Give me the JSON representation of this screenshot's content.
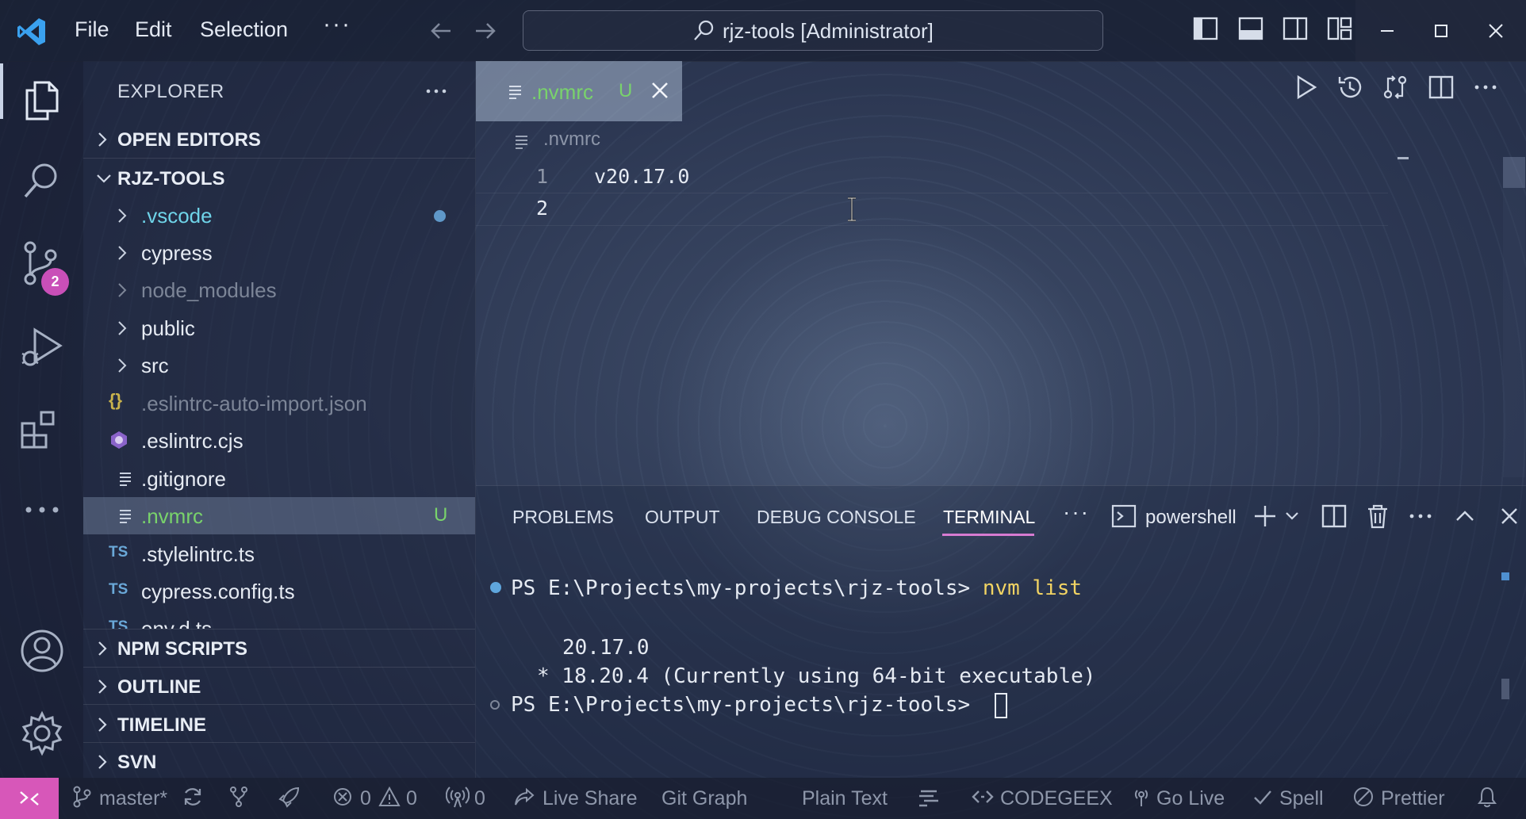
{
  "titlebar": {
    "menus": [
      "File",
      "Edit",
      "Selection"
    ],
    "more": "···",
    "search_text": "rjz-tools [Administrator]"
  },
  "activity": {
    "scm_badge": "2"
  },
  "sidebar": {
    "title": "EXPLORER",
    "sections": {
      "open_editors": "OPEN EDITORS",
      "project": "RJZ-TOOLS",
      "npm_scripts": "NPM SCRIPTS",
      "outline": "OUTLINE",
      "timeline": "TIMELINE",
      "svn": "SVN"
    },
    "tree": {
      "vscode": ".vscode",
      "cypress": "cypress",
      "node_modules": "node_modules",
      "public": "public",
      "src": "src",
      "eslintrc_auto_import": ".eslintrc-auto-import.json",
      "eslintrc_cjs": ".eslintrc.cjs",
      "gitignore": ".gitignore",
      "nvmrc": ".nvmrc",
      "stylelintrc": ".stylelintrc.ts",
      "cypress_config": "cypress.config.ts",
      "env_d": "env.d.ts"
    },
    "untracked_mark": "U",
    "ts_label": "TS"
  },
  "editor": {
    "tab_label": ".nvmrc",
    "tab_status": "U",
    "breadcrumb": ".nvmrc",
    "lines": [
      {
        "num": "1",
        "text": "v20.17.0"
      },
      {
        "num": "2",
        "text": ""
      }
    ]
  },
  "panel": {
    "tabs": [
      "PROBLEMS",
      "OUTPUT",
      "DEBUG CONSOLE",
      "TERMINAL"
    ],
    "active_tab": "TERMINAL",
    "more": "···",
    "shell": "powershell",
    "terminal": {
      "prompt1": "PS E:\\Projects\\my-projects\\rjz-tools> ",
      "cmd1": "nvm list",
      "out1": "20.17.0",
      "out2": "* 18.20.4 (Currently using 64-bit executable)",
      "prompt2": "PS E:\\Projects\\my-projects\\rjz-tools> "
    }
  },
  "statusbar": {
    "branch": "master*",
    "errors": "0",
    "warnings": "0",
    "ports": "0",
    "live_share": "Live Share",
    "git_graph": "Git Graph",
    "language": "Plain Text",
    "codegeex": "CODEGEEX",
    "go_live": "Go Live",
    "spell": "Spell",
    "prettier": "Prettier"
  },
  "colors": {
    "accent_pink": "#d757b9",
    "untracked_green": "#79d36b",
    "folder_teal": "#6fd4e9",
    "terminal_tab_underline": "#d77bd1"
  }
}
